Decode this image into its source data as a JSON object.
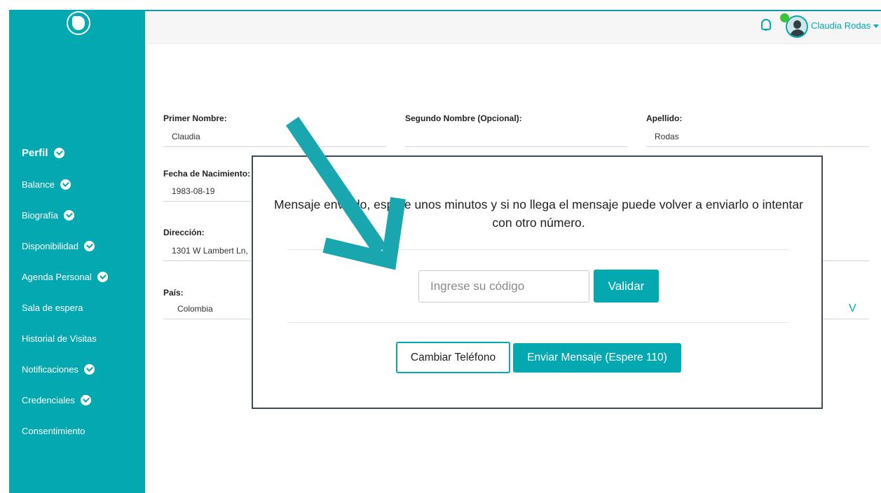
{
  "app": {
    "logo_icon": "brand-logo-icon",
    "accent_color": "#04a8b0",
    "modal_border_color": "#3e4c59"
  },
  "sidebar": {
    "items": [
      {
        "label": "Perfil",
        "completed": true,
        "active": true
      },
      {
        "label": "Balance",
        "completed": true
      },
      {
        "label": "Biografía",
        "completed": true
      },
      {
        "label": "Disponibilidad",
        "completed": true
      },
      {
        "label": "Agenda Personal",
        "completed": true
      },
      {
        "label": "Sala de espera",
        "completed": false
      },
      {
        "label": "Historial de Visitas",
        "completed": false
      },
      {
        "label": "Notificaciones",
        "completed": true
      },
      {
        "label": "Credenciales",
        "completed": true
      },
      {
        "label": "Consentimiento",
        "completed": false
      }
    ]
  },
  "header": {
    "bell_icon": "bell-icon",
    "user_name": "Claudia Rodas",
    "online_status_color": "#3ac43a"
  },
  "form": {
    "first_name": {
      "label": "Primer Nombre:",
      "value": "Claudia"
    },
    "middle_name": {
      "label": "Segundo Nombre (Opcional):",
      "value": ""
    },
    "last_name": {
      "label": "Apellido:",
      "value": "Rodas"
    },
    "birth_date": {
      "label": "Fecha de Nacimiento:",
      "value": "1983-08-19"
    },
    "address": {
      "label": "Dirección:",
      "value": "1301 W Lambert Ln,"
    },
    "country": {
      "label": "País:",
      "value": "Colombia",
      "chevron": "V"
    }
  },
  "modal": {
    "message": "Mensaje enviado, espere unos minutos y si no llega el mensaje puede volver a enviarlo o intentar con otro número.",
    "code_placeholder": "Ingrese su código",
    "validate_label": "Validar",
    "change_phone_label": "Cambiar Teléfono",
    "send_message_label": "Enviar Mensaje (Espere 110)"
  }
}
